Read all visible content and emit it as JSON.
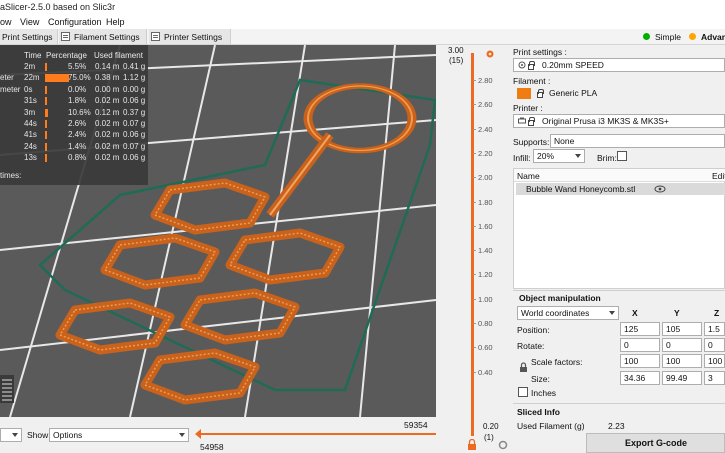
{
  "window": {
    "title": "aSlicer-2.5.0 based on Slic3r"
  },
  "menu": [
    "ow",
    "View",
    "Configuration",
    "Help"
  ],
  "tabs": {
    "print_settings": "Print Settings",
    "filament_settings": "Filament Settings",
    "printer_settings": "Printer Settings"
  },
  "modes": {
    "simple": "Simple",
    "advanced": "Advar",
    "simple_color": "#00b000",
    "advanced_color": "#ffa500"
  },
  "legend": {
    "headers": {
      "time": "Time",
      "percentage": "Percentage",
      "used": "Used filament"
    },
    "rows": [
      {
        "label": "",
        "time": "2m",
        "pct": "5.5%",
        "m": "0.14 m",
        "g": "0.41 g",
        "frac": 0.055
      },
      {
        "label": "eter",
        "time": "22m",
        "pct": "75.0%",
        "m": "0.38 m",
        "g": "1.12 g",
        "frac": 0.75
      },
      {
        "label": "meter",
        "time": "0s",
        "pct": "0.0%",
        "m": "0.00 m",
        "g": "0.00 g",
        "frac": 0.0
      },
      {
        "label": "",
        "time": "31s",
        "pct": "1.8%",
        "m": "0.02 m",
        "g": "0.06 g",
        "frac": 0.018
      },
      {
        "label": "",
        "time": "3m",
        "pct": "10.6%",
        "m": "0.12 m",
        "g": "0.37 g",
        "frac": 0.106
      },
      {
        "label": "",
        "time": "44s",
        "pct": "2.6%",
        "m": "0.02 m",
        "g": "0.07 g",
        "frac": 0.026
      },
      {
        "label": "",
        "time": "41s",
        "pct": "2.4%",
        "m": "0.02 m",
        "g": "0.06 g",
        "frac": 0.024
      },
      {
        "label": "",
        "time": "24s",
        "pct": "1.4%",
        "m": "0.02 m",
        "g": "0.07 g",
        "frac": 0.014
      },
      {
        "label": "",
        "time": "13s",
        "pct": "0.8%",
        "m": "0.02 m",
        "g": "0.06 g",
        "frac": 0.008
      }
    ],
    "footer": "times:"
  },
  "bottom": {
    "show_label": "Show",
    "show_value": "Options",
    "hslider_top": "59354",
    "hslider_bottom": "54958"
  },
  "vslider": {
    "top_value": "3.00",
    "top_layer": "(15)",
    "ticks": [
      "2.80",
      "2.60",
      "2.40",
      "2.20",
      "2.00",
      "1.80",
      "1.60",
      "1.40",
      "1.20",
      "1.00",
      "0.80",
      "0.60",
      "0.40"
    ],
    "bottom_value": "0.20",
    "bottom_layer": "(1)"
  },
  "panel": {
    "print_settings_label": "Print settings :",
    "print_profile": "0.20mm SPEED",
    "filament_label": "Filament :",
    "filament_profile": "Generic PLA",
    "filament_color": "#f07d12",
    "printer_label": "Printer :",
    "printer_profile": "Original Prusa i3 MK3S & MK3S+",
    "supports_label": "Supports:",
    "supports_value": "None",
    "infill_label": "Infill:",
    "infill_value": "20%",
    "brim_label": "Brim:",
    "list_col_name": "Name",
    "list_col_edit": "Edit",
    "object_name": "Bubble Wand Honeycomb.stl",
    "object_manipulation": "Object manipulation",
    "coords": "World coordinates",
    "axis": [
      "X",
      "Y",
      "Z"
    ],
    "position_label": "Position:",
    "position": [
      "125",
      "105",
      "1.5"
    ],
    "rotate_label": "Rotate:",
    "rotate": [
      "0",
      "0",
      "0"
    ],
    "scale_label": "Scale factors:",
    "scale": [
      "100",
      "100",
      "100"
    ],
    "size_label": "Size:",
    "size": [
      "34.36",
      "99.49",
      "3"
    ],
    "inches_label": "Inches",
    "sliced_info": "Sliced Info",
    "used_filament_label": "Used Filament (g)",
    "used_filament_value": "2.23",
    "export": "Export G-code"
  },
  "colors": {
    "accent": "#ed6b21",
    "toolpath": "#d2691e",
    "skirt": "#1f6b55"
  }
}
